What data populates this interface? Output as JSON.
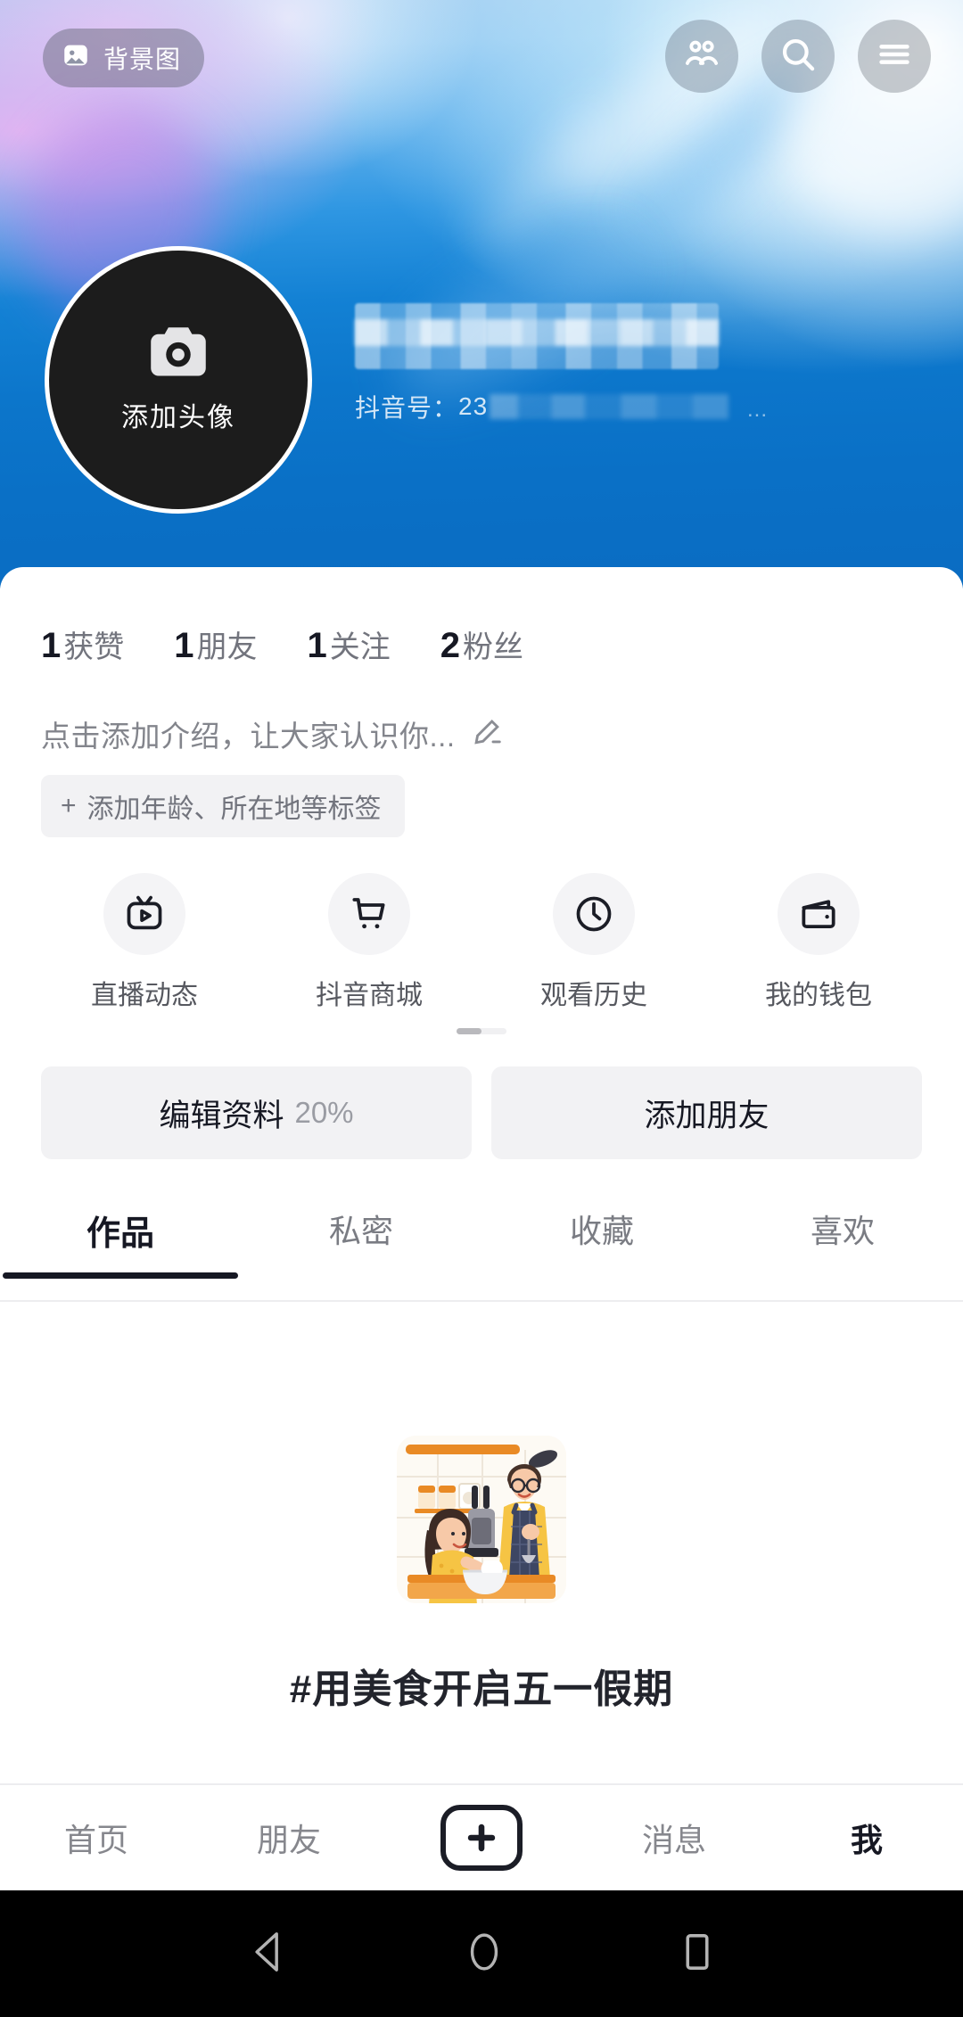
{
  "header": {
    "background_button_label": "背景图",
    "background_button_icon": "image-icon",
    "actions": [
      {
        "name": "friends-icon",
        "label": "好友"
      },
      {
        "name": "search-icon",
        "label": "搜索"
      },
      {
        "name": "menu-icon",
        "label": "菜单"
      }
    ]
  },
  "profile": {
    "avatar_action_label": "添加头像",
    "avatar_icon": "camera-icon",
    "nickname": "",
    "nickname_censored": true,
    "douyin_id_label": "抖音号：",
    "douyin_id_value": "23",
    "douyin_id_censored": true,
    "id_truncation": "..."
  },
  "stats": [
    {
      "num": "1",
      "label": "获赞"
    },
    {
      "num": "1",
      "label": "朋友"
    },
    {
      "num": "1",
      "label": "关注"
    },
    {
      "num": "2",
      "label": "粉丝"
    }
  ],
  "bio": {
    "placeholder": "点击添加介绍，让大家认识你...",
    "edit_icon": "pencil-icon",
    "tag_plus": "+",
    "tag_label": "添加年龄、所在地等标签"
  },
  "quick_actions": [
    {
      "icon": "live-tv-icon",
      "label": "直播动态"
    },
    {
      "icon": "cart-icon",
      "label": "抖音商城"
    },
    {
      "icon": "clock-icon",
      "label": "观看历史"
    },
    {
      "icon": "wallet-icon",
      "label": "我的钱包"
    }
  ],
  "action_buttons": {
    "edit_profile_label": "编辑资料",
    "edit_profile_percent": "20%",
    "add_friend_label": "添加朋友"
  },
  "tabs": [
    {
      "label": "作品",
      "active": true
    },
    {
      "label": "私密",
      "active": false
    },
    {
      "label": "收藏",
      "active": false
    },
    {
      "label": "喜欢",
      "active": false
    }
  ],
  "empty_state": {
    "illustration": "cooking-couple-illustration",
    "hashtag": "#用美食开启五一假期"
  },
  "bottom_nav": [
    {
      "label": "首页",
      "active": false
    },
    {
      "label": "朋友",
      "active": false
    },
    {
      "label": "+",
      "active": false,
      "icon": "plus-icon"
    },
    {
      "label": "消息",
      "active": false
    },
    {
      "label": "我",
      "active": true
    }
  ],
  "system_nav": [
    {
      "icon": "back-triangle-icon"
    },
    {
      "icon": "home-circle-icon"
    },
    {
      "icon": "recents-square-icon"
    }
  ],
  "colors": {
    "accent_blue": "#0a70c6",
    "text_primary": "#161823",
    "text_secondary": "#72747d",
    "chip_bg": "#f2f2f4"
  }
}
